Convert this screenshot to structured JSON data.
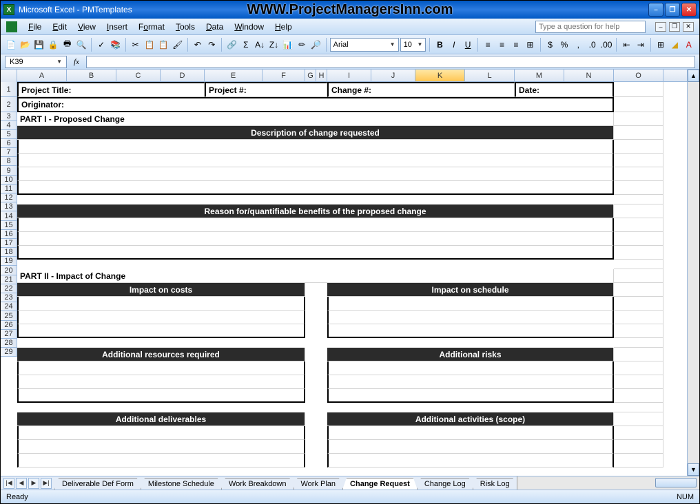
{
  "title": "Microsoft Excel - PMTemplates",
  "watermark": "WWW.ProjectManagersInn.com",
  "menu": [
    "File",
    "Edit",
    "View",
    "Insert",
    "Format",
    "Tools",
    "Data",
    "Window",
    "Help"
  ],
  "help_placeholder": "Type a question for help",
  "namebox": "K39",
  "fx_label": "fx",
  "font_name": "Arial",
  "font_size": "10",
  "columns": [
    "A",
    "B",
    "C",
    "D",
    "E",
    "F",
    "G",
    "H",
    "I",
    "J",
    "K",
    "L",
    "M",
    "N",
    "O"
  ],
  "selected_col": "K",
  "row_count": 29,
  "fields": {
    "project_title": "Project Title:",
    "project_num": "Project #:",
    "change_num": "Change #:",
    "date": "Date:",
    "originator": "Originator:"
  },
  "sections": {
    "part1": "PART I - Proposed Change",
    "desc": "Description of change requested",
    "reason": "Reason for/quantifiable benefits of the proposed change",
    "part2": "PART II - Impact of Change",
    "costs": "Impact on costs",
    "schedule": "Impact on schedule",
    "resources": "Additional resources required",
    "risks": "Additional risks",
    "deliverables": "Additional deliverables",
    "activities": "Additional activities (scope)"
  },
  "sheets": [
    "Deliverable Def Form",
    "Milestone Schedule",
    "Work Breakdown",
    "Work Plan",
    "Change Request",
    "Change Log",
    "Risk Log"
  ],
  "active_sheet": "Change Request",
  "status": "Ready",
  "status_indicator": "NUM"
}
